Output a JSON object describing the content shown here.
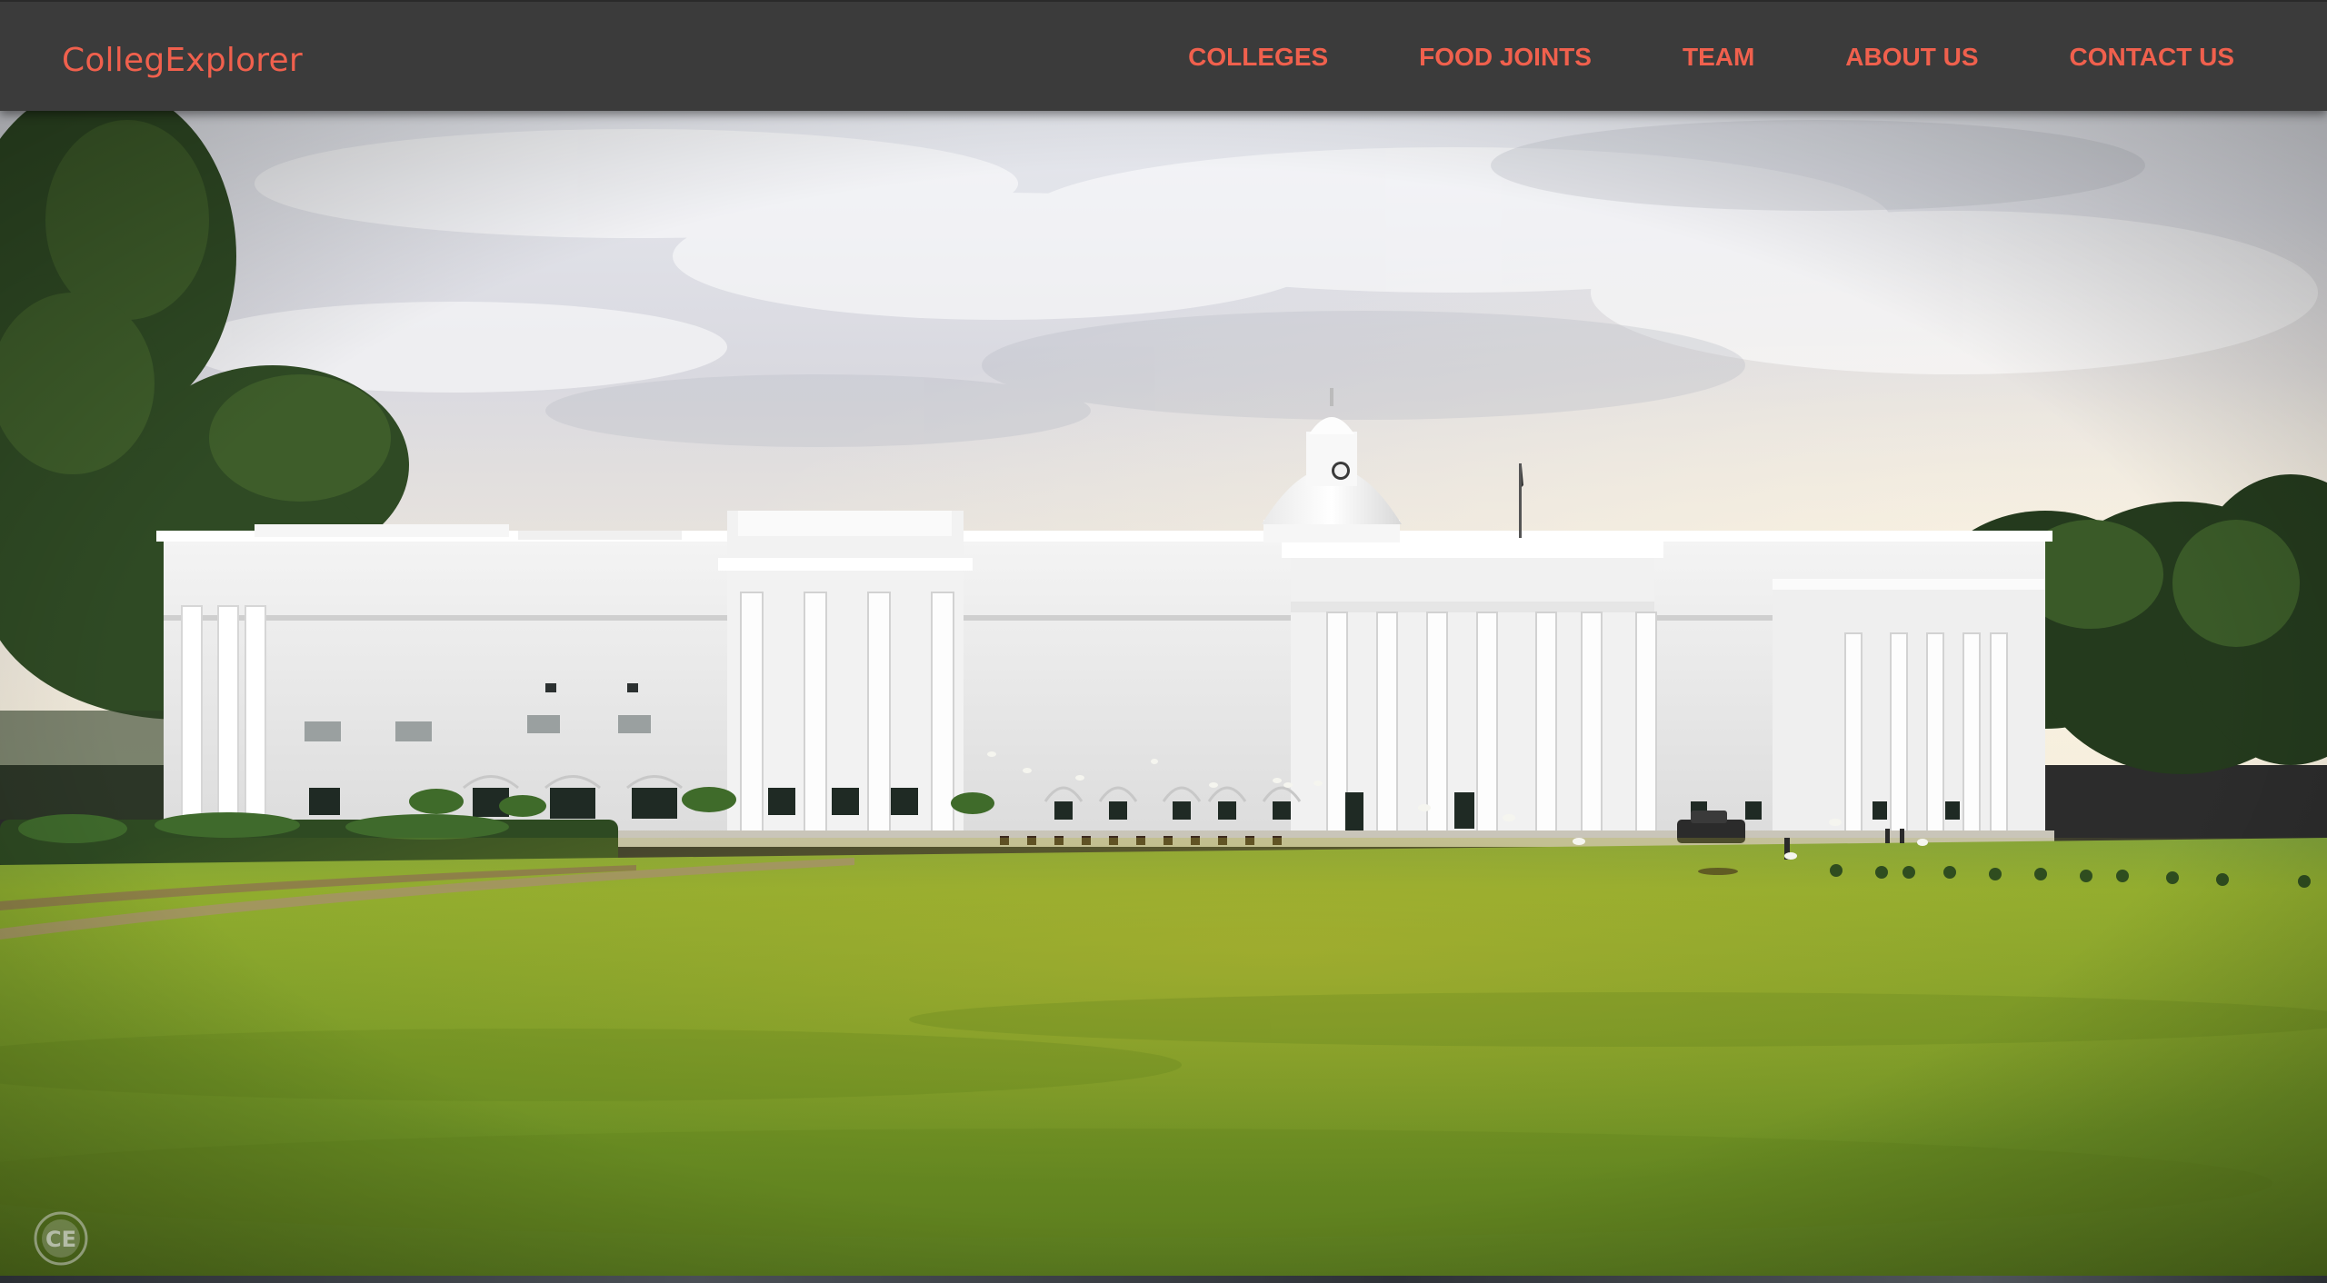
{
  "brand": {
    "name": "CollegExplorer"
  },
  "nav": {
    "items": [
      {
        "label": "COLLEGES"
      },
      {
        "label": "FOOD JOINTS"
      },
      {
        "label": "TEAM"
      },
      {
        "label": "ABOUT US"
      },
      {
        "label": "CONTACT US"
      }
    ]
  },
  "hero": {
    "image": "college-main-building-photo",
    "watermark_logo_text": "CE"
  },
  "colors": {
    "navbar_bg": "#3b3b3b",
    "accent": "#f0604d"
  }
}
